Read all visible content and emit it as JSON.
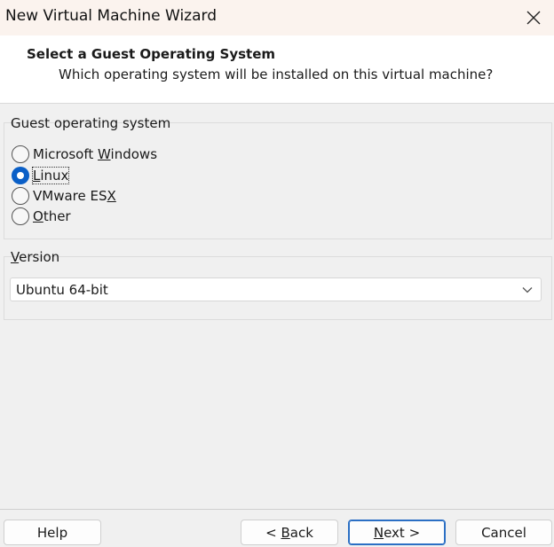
{
  "window": {
    "title": "New Virtual Machine Wizard",
    "close_icon": "close-icon"
  },
  "header": {
    "title": "Select a Guest Operating System",
    "subtitle": "Which operating system will be installed on this virtual machine?"
  },
  "guest_os": {
    "group_label": "Guest operating system",
    "options": [
      {
        "pre": "Microsoft ",
        "key": "W",
        "post": "indows",
        "selected": false
      },
      {
        "pre": "",
        "key": "L",
        "post": "inux",
        "selected": true
      },
      {
        "pre": "VMware ES",
        "key": "X",
        "post": "",
        "selected": false
      },
      {
        "pre": "",
        "key": "O",
        "post": "ther",
        "selected": false
      }
    ]
  },
  "version": {
    "group_label_key": "V",
    "group_label_rest": "ersion",
    "selected": "Ubuntu 64-bit",
    "dropdown_icon": "chevron-down-icon"
  },
  "buttons": {
    "help": "Help",
    "back_pre": "< ",
    "back_key": "B",
    "back_post": "ack",
    "next_key": "N",
    "next_post": "ext >",
    "cancel": "Cancel"
  }
}
